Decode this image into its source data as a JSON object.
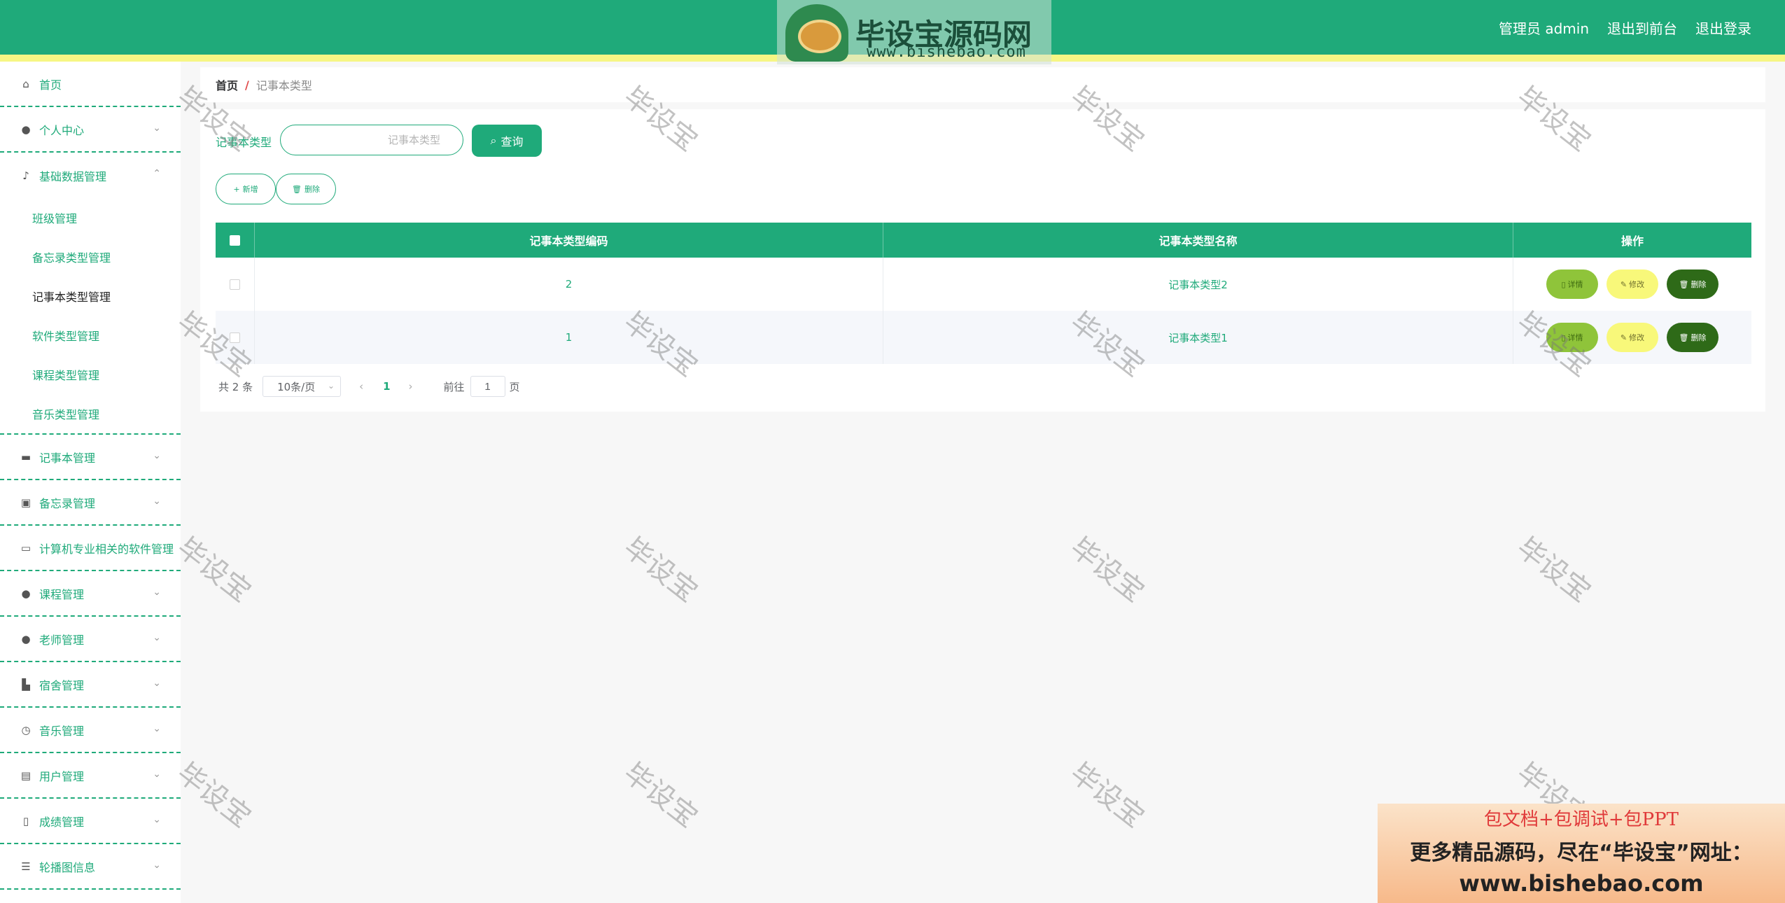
{
  "header": {
    "user_label": "管理员 admin",
    "to_front": "退出到前台",
    "logout": "退出登录",
    "logo_title": "毕设宝源码网",
    "logo_url": "www.bishebao.com"
  },
  "colors": {
    "primary": "#1faa7a",
    "stripe": "#f6f684",
    "danger_sep": "#e04949"
  },
  "sidebar": {
    "home": {
      "label": "首页",
      "icon": "home-icon"
    },
    "profile": {
      "label": "个人中心",
      "icon": "user-icon"
    },
    "basic": {
      "label": "基础数据管理",
      "icon": "bell-off-icon",
      "children": [
        "班级管理",
        "备忘录类型管理",
        "记事本类型管理",
        "软件类型管理",
        "课程类型管理",
        "音乐类型管理"
      ]
    },
    "notebook": {
      "label": "记事本管理",
      "icon": "monitor-icon"
    },
    "memo": {
      "label": "备忘录管理",
      "icon": "chart-icon"
    },
    "software": {
      "label": "计算机专业相关的软件管理",
      "icon": "chat-icon"
    },
    "course": {
      "label": "课程管理",
      "icon": "user-icon"
    },
    "teacher": {
      "label": "老师管理",
      "icon": "user-icon"
    },
    "dorm": {
      "label": "宿舍管理",
      "icon": "thumb-icon"
    },
    "music": {
      "label": "音乐管理",
      "icon": "compass-icon"
    },
    "users": {
      "label": "用户管理",
      "icon": "clipboard-icon"
    },
    "grades": {
      "label": "成绩管理",
      "icon": "microphone-icon"
    },
    "carousel": {
      "label": "轮播图信息",
      "icon": "sliders-icon"
    }
  },
  "breadcrumb": {
    "home": "首页",
    "sep": "/",
    "current": "记事本类型"
  },
  "search": {
    "label": "记事本类型",
    "placeholder": "记事本类型",
    "button": "查询"
  },
  "actions": {
    "add": "新增",
    "delete": "删除"
  },
  "table": {
    "headers": {
      "code": "记事本类型编码",
      "name": "记事本类型名称",
      "ops": "操作"
    },
    "rows": [
      {
        "code": "2",
        "name": "记事本类型2"
      },
      {
        "code": "1",
        "name": "记事本类型1"
      }
    ],
    "op_labels": {
      "detail": "详情",
      "edit": "修改",
      "delete": "删除"
    }
  },
  "pagination": {
    "total": "共 2 条",
    "page_size": "10条/页",
    "current_page": "1",
    "goto_label": "前往",
    "goto_value": "1",
    "page_suffix": "页"
  },
  "watermark": "毕设宝",
  "ad": {
    "line1": "包文档+包调试+包PPT",
    "line2": "更多精品源码，尽在“毕设宝”网址：",
    "line3": "www.bishebao.com"
  }
}
